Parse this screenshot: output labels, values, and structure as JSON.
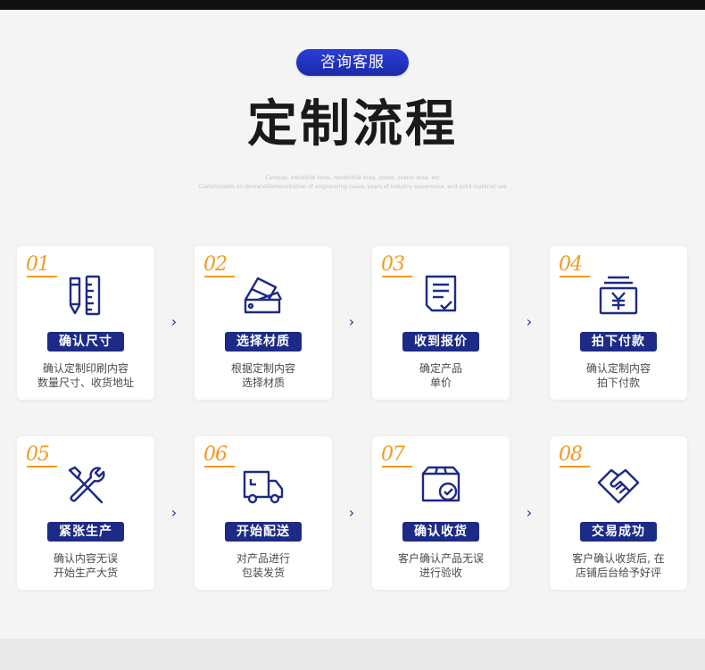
{
  "header": {
    "pill_label": "咨询客服",
    "title": "定制流程",
    "subtitle_line1": "Campus, industrial zone, residential area, street, scenic area, etc",
    "subtitle_line2": "Customizable on demandDemonstration of engineering cases, years of industry experience, and solid material use"
  },
  "arrow_glyph": "›",
  "steps": [
    {
      "num": "01",
      "badge": "确认尺寸",
      "desc1": "确认定制印刷内容",
      "desc2": "数量尺寸、收货地址",
      "icon": "ruler-pencil-icon"
    },
    {
      "num": "02",
      "badge": "选择材质",
      "desc1": "根据定制内容",
      "desc2": "选择材质",
      "icon": "swatch-fan-icon"
    },
    {
      "num": "03",
      "badge": "收到报价",
      "desc1": "确定产品",
      "desc2": "单价",
      "icon": "quote-document-icon"
    },
    {
      "num": "04",
      "badge": "拍下付款",
      "desc1": "确认定制内容",
      "desc2": "拍下付款",
      "icon": "yen-payment-icon"
    },
    {
      "num": "05",
      "badge": "紧张生产",
      "desc1": "确认内容无误",
      "desc2": "开始生产大货",
      "icon": "tools-icon"
    },
    {
      "num": "06",
      "badge": "开始配送",
      "desc1": "对产品进行",
      "desc2": "包装发货",
      "icon": "delivery-truck-icon"
    },
    {
      "num": "07",
      "badge": "确认收货",
      "desc1": "客户确认产品无误",
      "desc2": "进行验收",
      "icon": "box-check-icon"
    },
    {
      "num": "08",
      "badge": "交易成功",
      "desc1": "客户确认收货后, 在",
      "desc2": "店铺后台给予好评",
      "icon": "handshake-icon"
    }
  ],
  "colors": {
    "accent_orange": "#f39a1f",
    "navy": "#1d2a86",
    "pill_blue": "#2236c8"
  }
}
